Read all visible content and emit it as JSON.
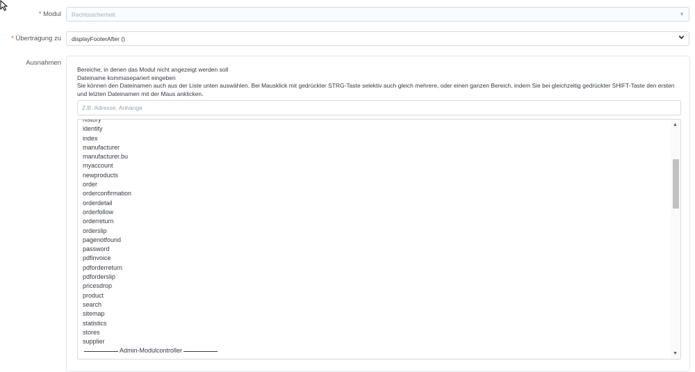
{
  "form": {
    "module": {
      "label": "Modul",
      "required_mark": "*",
      "value": "Rechtssicherheit"
    },
    "hook": {
      "label": "Übertragung zu",
      "required_mark": "*",
      "value": "displayFooterAfter ()"
    },
    "exceptions": {
      "label": "Ausnahmen",
      "help_lines": [
        "Bereiche, in denen das Modul nicht angezeigt werden soll",
        "Dateiname kommasepariert eingeben",
        "Sie können den Dateinamen auch aus der Liste unten auswählen. Bei Mausklick mit gedrückter STRG-Taste selektiv auch gleich mehrere, oder einen ganzen Bereich, indem Sie bei gleichzeitig gedrückter SHIFT-Taste den ersten und letzten Dateinamen mit der Maus anklicken."
      ],
      "filter_placeholder": "Z.B. Adresse, Anhänge",
      "list_items": [
        "history",
        "identity",
        "index",
        "manufacturer",
        "manufacturer.bu",
        "myaccount",
        "newproducts",
        "order",
        "orderconfirmation",
        "orderdetail",
        "orderfollow",
        "orderreturn",
        "orderslip",
        "pagenotfound",
        "password",
        "pdfinvoice",
        "pdforderreturn",
        "pdforderslip",
        "pricesdrop",
        "product",
        "search",
        "sitemap",
        "statistics",
        "stores",
        "supplier"
      ],
      "list_separator": "Admin-Modulcontroller"
    }
  },
  "icons": {
    "cursor": "mouse-pointer-icon",
    "select_arrow": "chevron-down-icon",
    "scroll_up": "triangle-up-icon",
    "scroll_down": "triangle-down-icon"
  },
  "colors": {
    "required": "#e44444",
    "text": "#363a41",
    "border": "#d6d9dd"
  }
}
